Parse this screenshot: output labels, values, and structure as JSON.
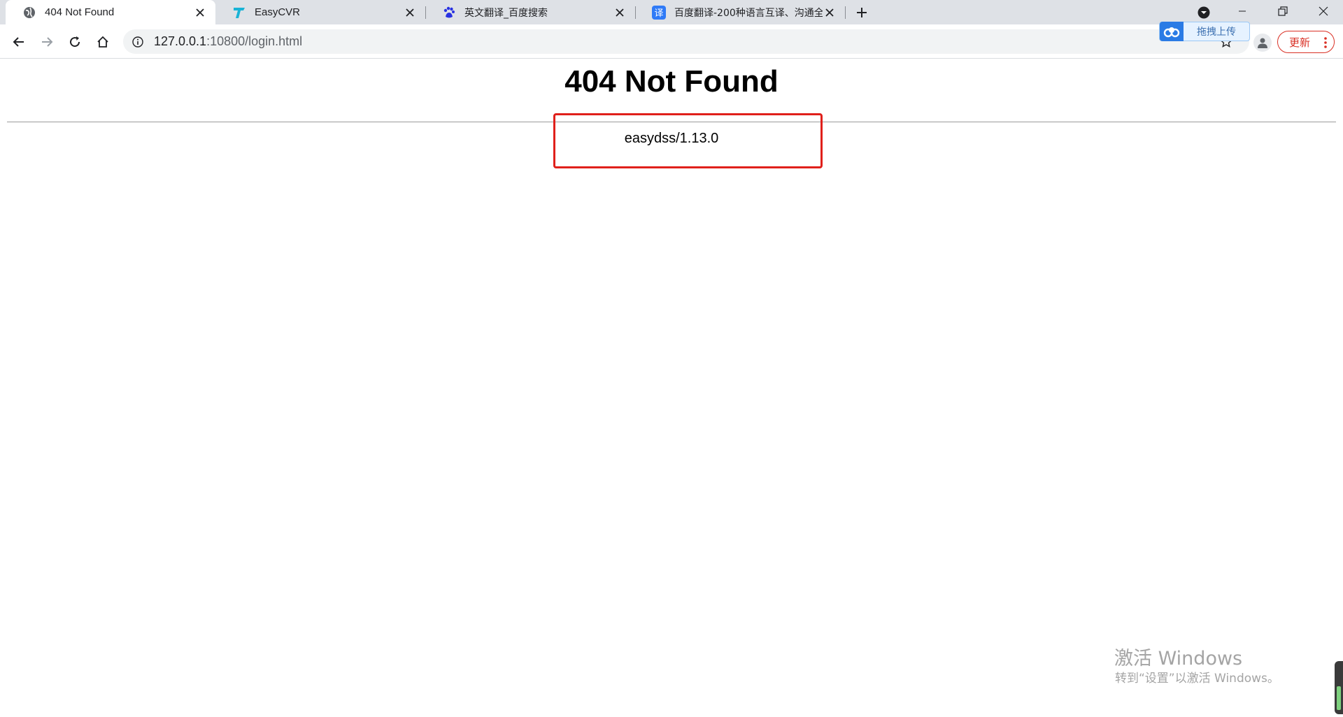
{
  "browser": {
    "tabs": [
      {
        "title": "404 Not Found",
        "icon": "globe-icon"
      },
      {
        "title": "EasyCVR",
        "icon": "easycvr-logo-icon"
      },
      {
        "title": "英文翻译_百度搜索",
        "icon": "baidu-paw-icon"
      },
      {
        "title": "百度翻译-200种语言互译、沟通全",
        "icon": "baidu-translate-icon"
      }
    ],
    "translate_favicon_char": "译",
    "address": {
      "host": "127.0.0.1",
      "rest": ":10800/login.html"
    },
    "update_label": "更新",
    "upload_widget_label": "拖拽上传",
    "colors": {
      "accent_red": "#d93025",
      "highlight_box": "#e0201b",
      "tab_strip": "#dee1e6"
    }
  },
  "page": {
    "title": "404 Not Found",
    "server_info": "easydss/1.13.0"
  },
  "watermark": {
    "title": "激活 Windows",
    "subtitle": "转到“设置”以激活 Windows。"
  }
}
